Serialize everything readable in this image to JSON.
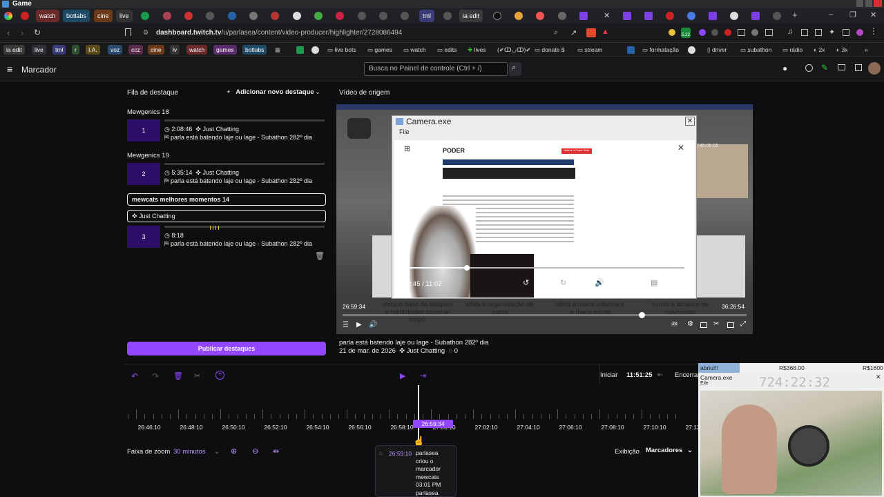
{
  "window": {
    "title": "Game"
  },
  "tabs": [
    {
      "label": "watch",
      "bg": "#6b2a2a"
    },
    {
      "label": "botlabs",
      "bg": "#1f4a66"
    },
    {
      "label": "cine",
      "bg": "#6b3a1a"
    },
    {
      "label": "live",
      "bg": "#333"
    },
    {
      "label": "tml",
      "bg": "#3b3b7a"
    },
    {
      "label": "ia edit",
      "bg": "#3a3a3d"
    }
  ],
  "browser": {
    "url_domain": "dashboard.twitch.tv",
    "url_path": "/u/parlasea/content/video-producer/highlighter/2728086494"
  },
  "bookmarks": {
    "chips": [
      {
        "label": "ia edit",
        "bg": "#3a3a3d"
      },
      {
        "label": "live",
        "bg": "#2f2f35"
      },
      {
        "label": "tml",
        "bg": "#3b3b7a"
      },
      {
        "label": "r",
        "bg": "#2f4f2f"
      },
      {
        "label": "I.A.",
        "bg": "#5b4a1a"
      },
      {
        "label": "voz",
        "bg": "#2b4a6b"
      },
      {
        "label": "ccz",
        "bg": "#5a2a4a"
      },
      {
        "label": "cine",
        "bg": "#6b3a1a"
      },
      {
        "label": "lv",
        "bg": "#333"
      },
      {
        "label": "watch",
        "bg": "#6b2a2a"
      },
      {
        "label": "games",
        "bg": "#5b2a6b"
      },
      {
        "label": "botlabs",
        "bg": "#1f4a66"
      }
    ],
    "folders": [
      "live bots",
      "games",
      "watch",
      "edits",
      "lives",
      "(✔ↀ◡ↀ)✔",
      "donate $",
      "stream",
      "formatação",
      "driver",
      "subathon",
      "rádio",
      "2x",
      "3x"
    ],
    "badge": "5.22"
  },
  "header": {
    "menu_title": "Marcador",
    "search_placeholder": "Busca no Painel de controle (Ctrl + /)"
  },
  "queue": {
    "title": "Fila de destaque",
    "add_label": "Adicionar novo destaque",
    "groups": [
      {
        "heading": "Mewgenics 18",
        "num": "1",
        "time": "2:08:46",
        "category": "Just Chatting",
        "title": "parla está batendo laje ou lage - Subathon 282º dia"
      },
      {
        "heading": "Mewgenics 19",
        "num": "2",
        "time": "5:35:14",
        "category": "Just Chatting",
        "title": "parla está batendo laje ou lage - Subathon 282º dia"
      }
    ],
    "edit_title_value": "mewcats melhores momentos 14",
    "edit_category_value": "Just Chatting",
    "clip3": {
      "num": "3",
      "time": "8:18",
      "title": "parla está batendo laje ou lage - Subathon 282º dia"
    },
    "publish_label": "Publicar destaques"
  },
  "video": {
    "title": "Vídeo de origem",
    "cam_title": "Camera.exe",
    "cam_menu": "File",
    "inner_time": "2:45 / 11:02",
    "inner_progress": 0.22,
    "time_left": "26:59:34",
    "time_right": "36:26:54",
    "overlay_time": "745:09:03",
    "speed": "2x",
    "captions": [
      "afeta o dano de ataques e habilidades corpo-a-corpo",
      "afeta a regeneração de mana",
      "afeta a mana máxima e a mana inicial",
      "turnos e alcance de movimento"
    ],
    "info_title": "parla está batendo laje ou lage - Subathon 282º dia",
    "info_date": "21 de mar. de 2026",
    "info_category": "Just Chatting",
    "info_views": "0",
    "news_site": "PODER",
    "news_badge": "Assine o Poder Sete"
  },
  "timeline": {
    "start_label": "Iniciar",
    "start_value": "11:51:25",
    "end_label": "Encerrar",
    "ticks": [
      "26:46:10",
      "26:48:10",
      "26:50:10",
      "26:52:10",
      "26:54:10",
      "26:56:10",
      "26:58:10",
      "27:00:10",
      "27:02:10",
      "27:04:10",
      "27:06:10",
      "27:08:10",
      "27:10:10",
      "27:12:10"
    ],
    "marker_label": "26:59:34",
    "zoom_label": "Faixa de zoom",
    "zoom_value": "30 minutos",
    "view_label": "Exibição",
    "view_value": "Marcadores"
  },
  "tooltip": {
    "time": "26:59:10",
    "text": "parlasea criou o marcador mewcats 03:01 PM parlasea"
  },
  "webcam": {
    "goal_label": "abriu!!!",
    "goal_amount": "R$368.00",
    "goal_target": "R$1600",
    "window_title": "Camera.exe",
    "file_label": "Eile",
    "timer": "724:22:32"
  }
}
